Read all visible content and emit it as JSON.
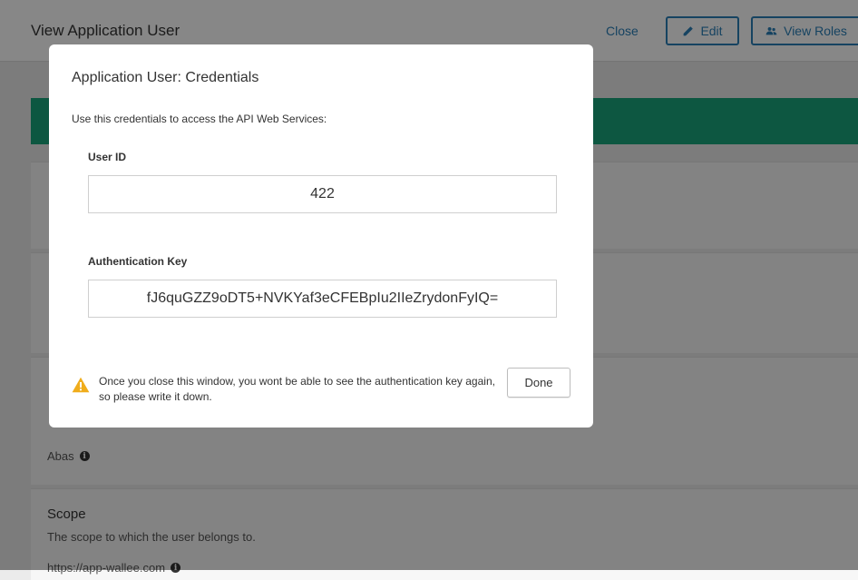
{
  "header": {
    "title": "View Application User",
    "close_label": "Close",
    "edit_label": "Edit",
    "view_roles_label": "View Roles"
  },
  "background": {
    "card3_value": "Abas",
    "scope": {
      "title": "Scope",
      "description": "The scope to which the user belongs to.",
      "value": "https://app-wallee.com"
    }
  },
  "modal": {
    "title": "Application User: Credentials",
    "intro": "Use this credentials to access the API Web Services:",
    "user_id_label": "User ID",
    "user_id_value": "422",
    "auth_key_label": "Authentication Key",
    "auth_key_value": "fJ6quGZZ9oDT5+NVKYaf3eCFEBpIu2IIeZrydonFyIQ=",
    "warning_text": "Once you close this window, you wont be able to see the authentication key again, so please write it down.",
    "done_label": "Done"
  },
  "colors": {
    "accent": "#2a7fb8",
    "success_bar": "#1aa57c",
    "warning": "#f0ad1c"
  },
  "icons": {
    "edit": "pencil-icon",
    "view_roles": "users-icon",
    "info": "info-icon",
    "warning": "warning-icon"
  }
}
